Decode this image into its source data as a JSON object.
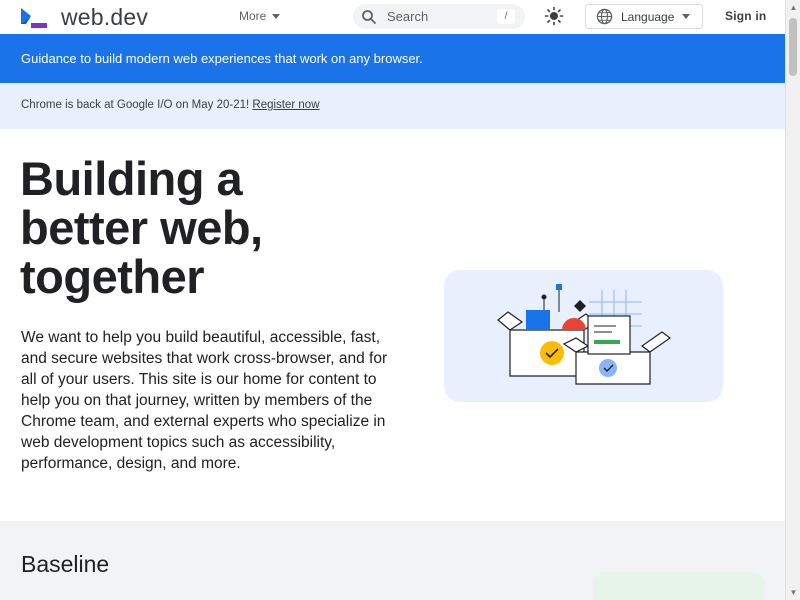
{
  "header": {
    "logo_text": "web.dev",
    "more_label": "More",
    "search_placeholder": "Search",
    "search_shortcut": "/",
    "language_label": "Language",
    "signin_label": "Sign in"
  },
  "banner": {
    "text": "Guidance to build modern web experiences that work on any browser."
  },
  "announcement": {
    "text": "Chrome is back at Google I/O on May 20-21! ",
    "link_label": "Register now"
  },
  "hero": {
    "title_lines": [
      "Building a",
      "better web,",
      "together"
    ],
    "description": "We want to help you build beautiful, accessible, fast, and secure websites that work cross-browser, and for all of your users. This site is our home for content to help you on that journey, written by members of the Chrome team, and external experts who specialize in web development topics such as accessibility, performance, design, and more."
  },
  "baseline": {
    "title": "Baseline"
  },
  "colors": {
    "brand_blue": "#1a73e8",
    "light_blue": "#e8f0fe",
    "section_gray": "#f1f3f4",
    "card_green": "#e6f4ea",
    "text": "#202124"
  },
  "icons": [
    "web-dev-logo-icon",
    "search-icon",
    "theme-toggle-icon",
    "globe-icon",
    "caret-down-icon"
  ]
}
